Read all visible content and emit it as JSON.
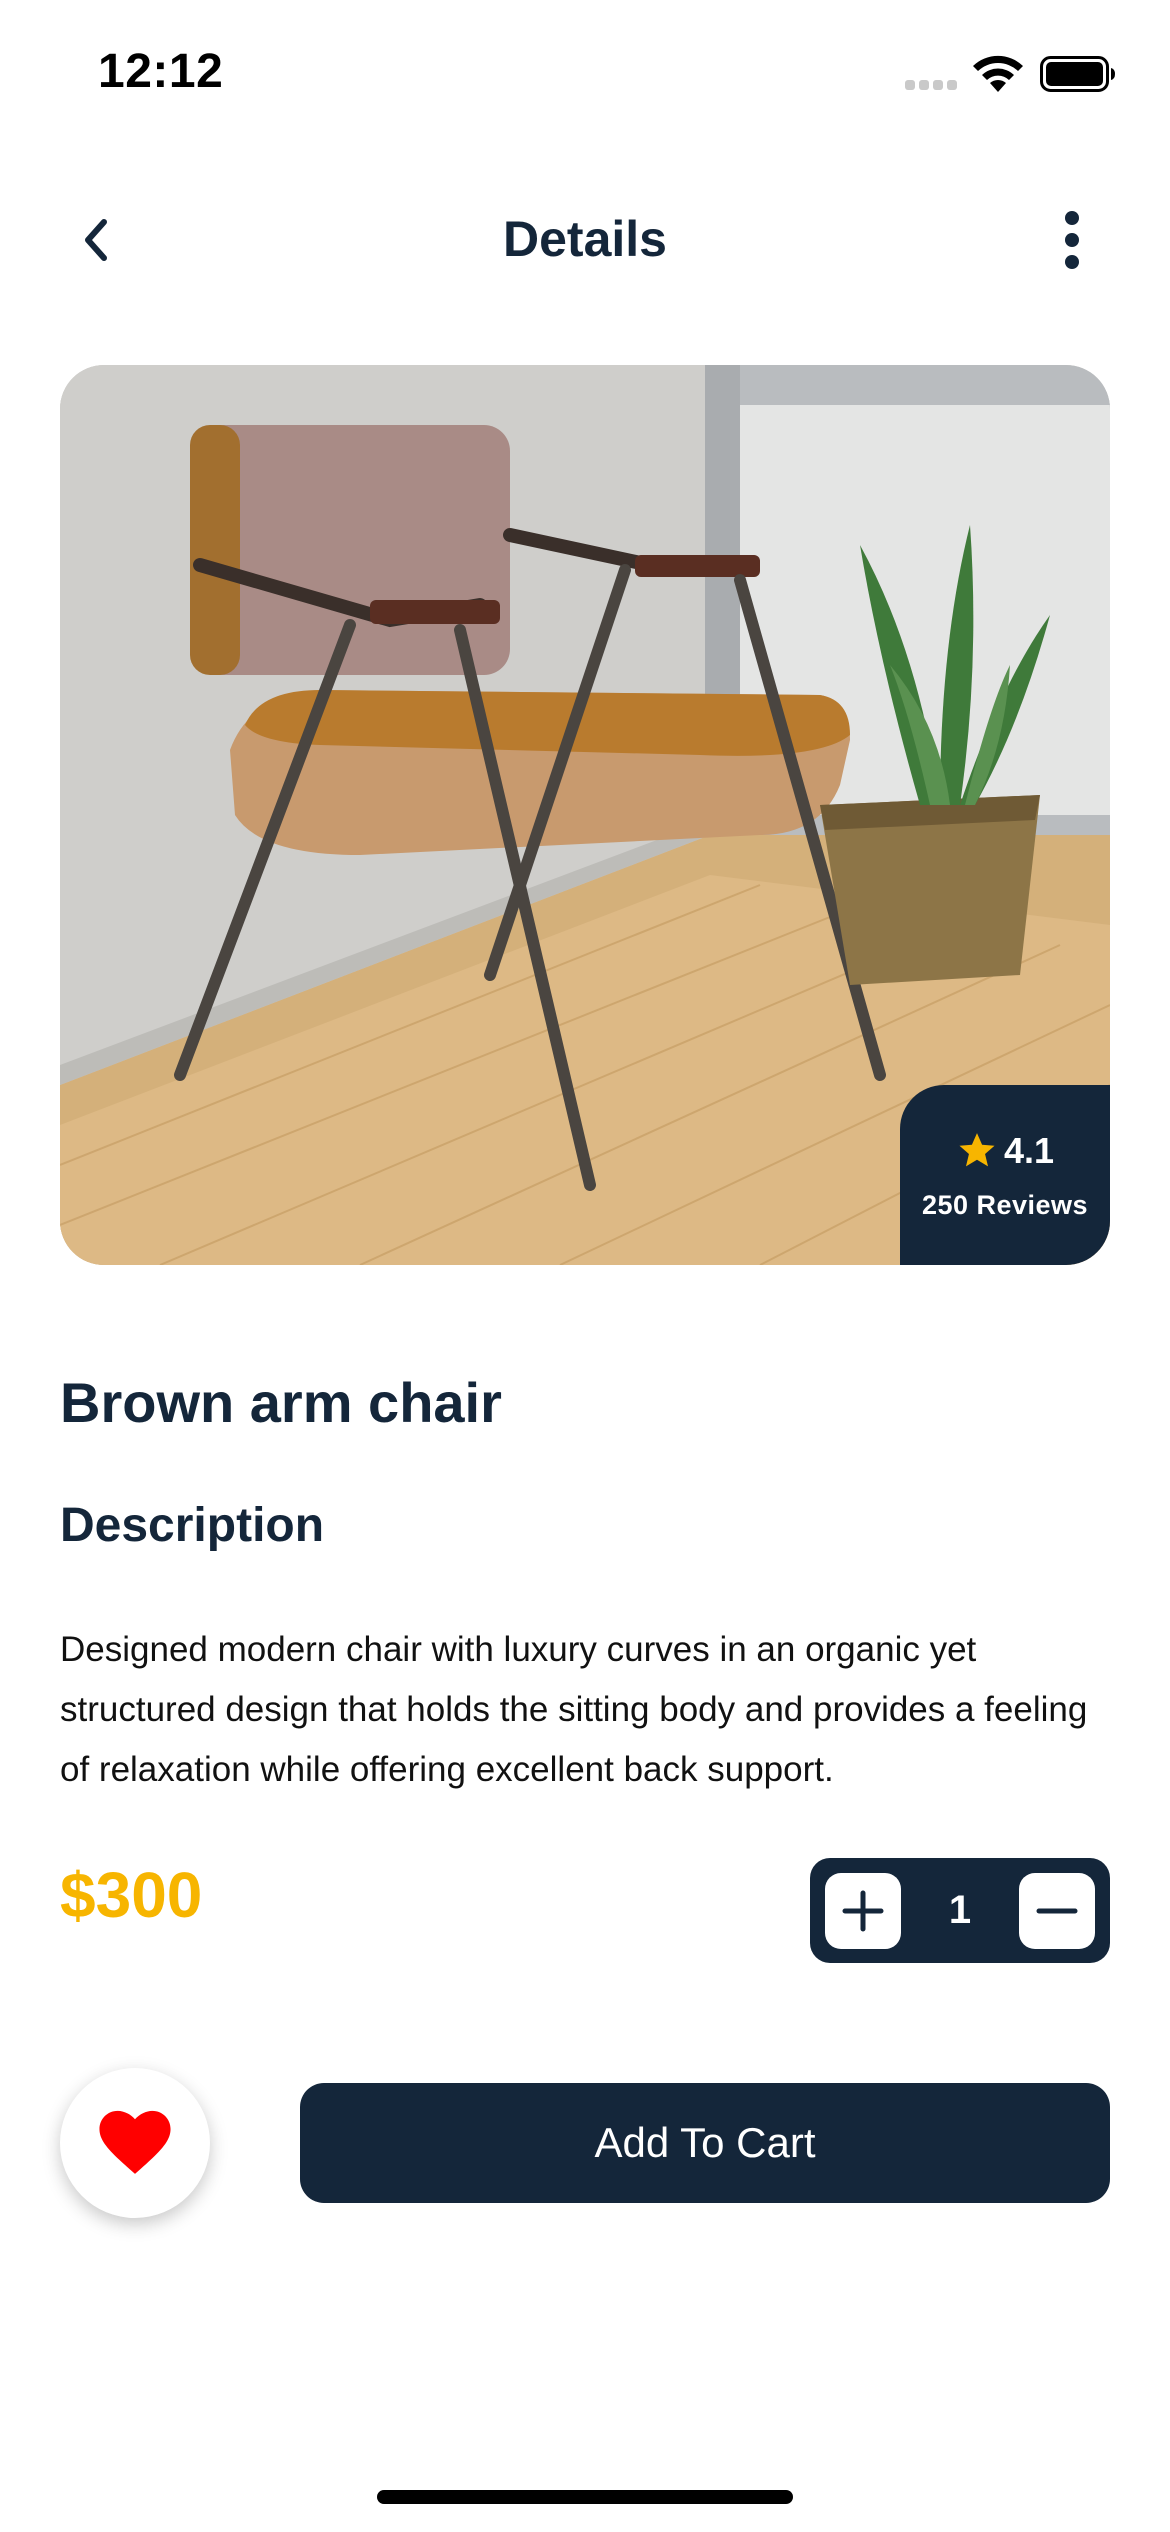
{
  "status_bar": {
    "time": "12:12"
  },
  "header": {
    "title": "Details"
  },
  "product": {
    "rating": "4.1",
    "reviews": "250 Reviews",
    "name": "Brown arm chair",
    "description_heading": "Description",
    "description": "Designed modern chair with luxury curves in an organic yet structured design that holds the sitting body and provides a feeling of relaxation while offering excellent back support.",
    "price": "$300",
    "quantity": "1"
  },
  "actions": {
    "add_to_cart_label": "Add To Cart"
  },
  "colors": {
    "primary": "#14263a",
    "price": "#f7b500",
    "star": "#f7b500",
    "heart": "#ff0000"
  },
  "icons": {
    "back": "chevron-left-icon",
    "more": "more-vertical-icon",
    "star": "star-icon",
    "plus": "plus-icon",
    "minus": "minus-icon",
    "favorite": "heart-icon"
  }
}
